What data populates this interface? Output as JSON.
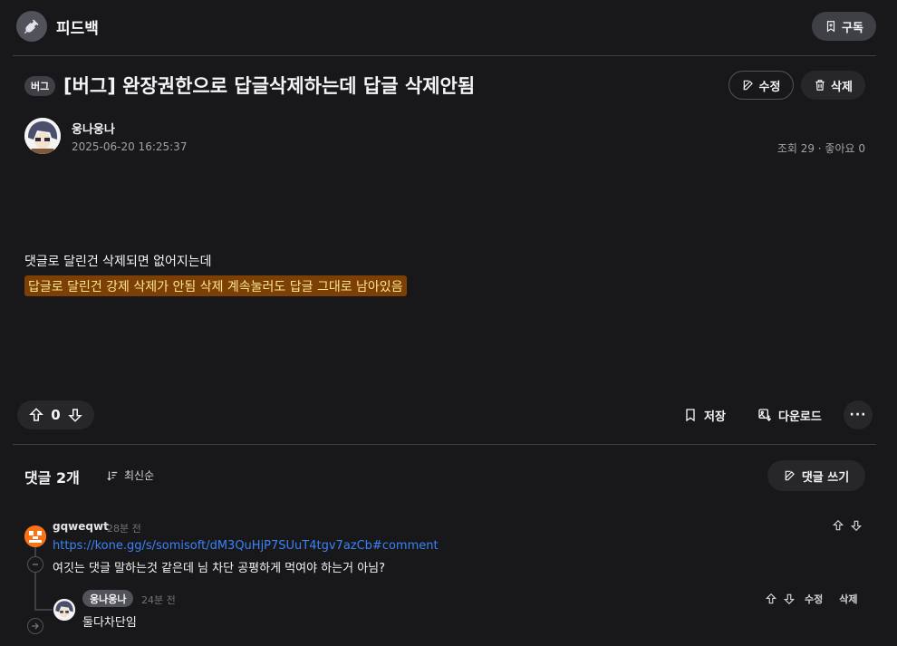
{
  "header": {
    "channel_name": "피드백",
    "subscribe_label": "구독"
  },
  "post": {
    "badge": "버그",
    "title": "[버그] 완장권한으로 답글삭제하는데 답글 삭제안됨",
    "edit_label": "수정",
    "delete_label": "삭제",
    "author": "웅나웅나",
    "date": "2025-06-20 16:25:37",
    "stats": "조회 29 · 좋아요 0",
    "body_line1": "댓글로 달린건 삭제되면 없어지는데",
    "body_line2": "답글로 달린건 강제 삭제가 안됨 삭제 계속눌러도 답글 그대로 남아있음",
    "vote_count": "0",
    "save_label": "저장",
    "download_label": "다운로드"
  },
  "comments": {
    "title": "댓글 2개",
    "sort_label": "최신순",
    "write_label": "댓글 쓰기",
    "items": [
      {
        "author": "gqweqwt",
        "time": "28분 전",
        "link": "https://kone.gg/s/somisoft/dM3QuHjP7SUuT4tgv7azCb#comment",
        "text": "여깃는 댓글 말하는것 같은데 님 차단 공평하게 먹여야 하는거 아님?"
      },
      {
        "author": "웅나웅나",
        "time": "24분 전",
        "text": "둘다차단임",
        "edit_label": "수정",
        "delete_label": "삭제"
      }
    ]
  },
  "colors": {
    "background": "#18181b",
    "highlight_bg": "#7c3f06",
    "highlight_text": "#fde68a",
    "link": "#3b82f6"
  }
}
